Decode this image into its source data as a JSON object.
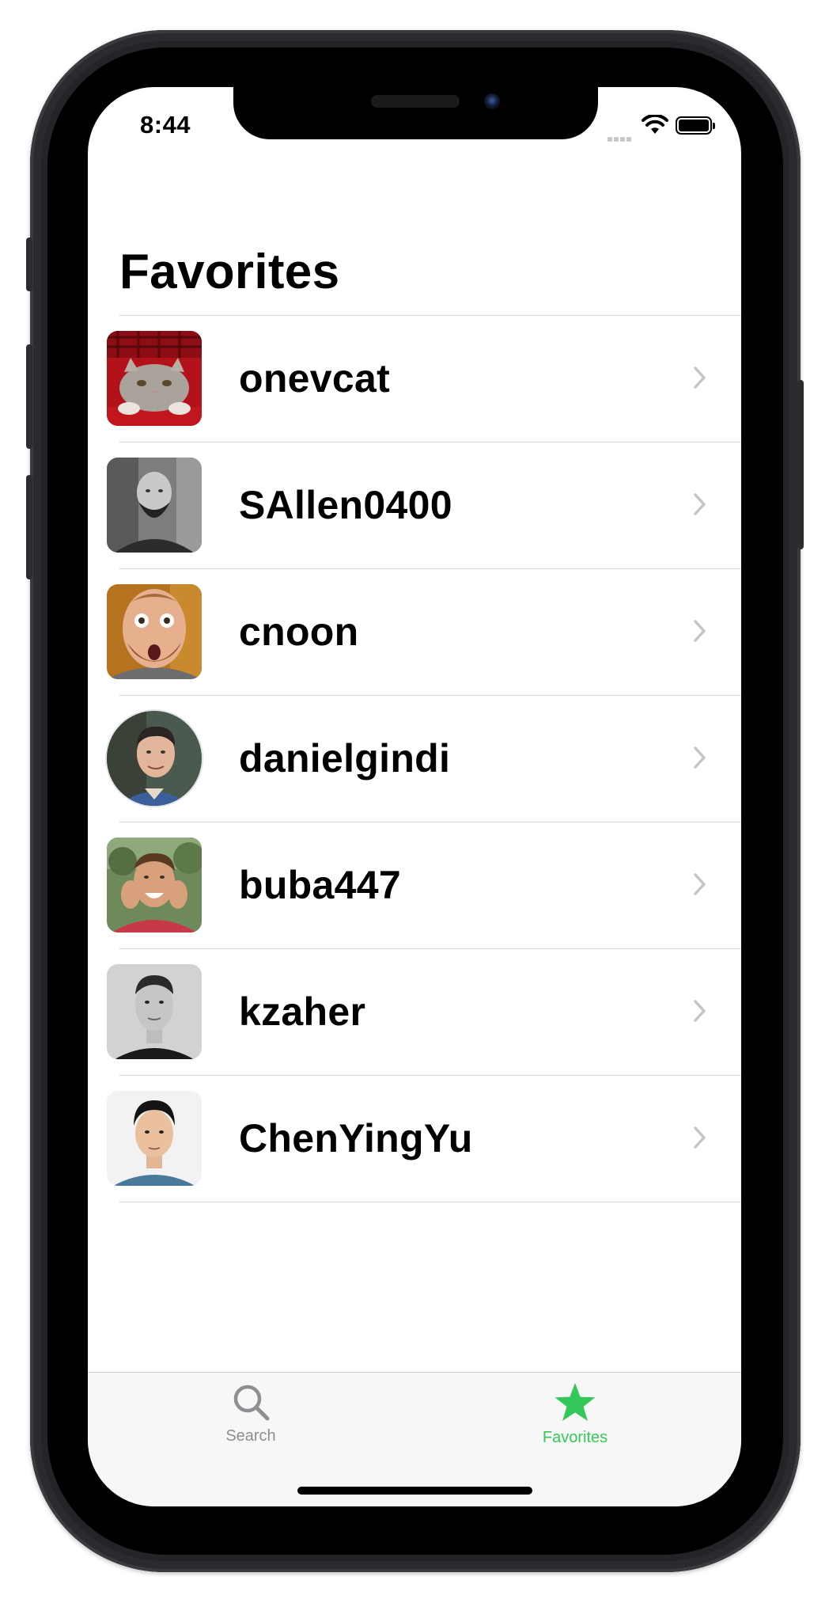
{
  "status_bar": {
    "time": "8:44"
  },
  "header": {
    "title": "Favorites"
  },
  "favorites": [
    {
      "name": "onevcat",
      "avatar": "cat-photo"
    },
    {
      "name": "SAllen0400",
      "avatar": "bearded-man-photo"
    },
    {
      "name": "cnoon",
      "avatar": "surprised-man-photo"
    },
    {
      "name": "danielgindi",
      "avatar": "smiling-man-photo"
    },
    {
      "name": "buba447",
      "avatar": "excited-man-photo"
    },
    {
      "name": "kzaher",
      "avatar": "man-bw-photo"
    },
    {
      "name": "ChenYingYu",
      "avatar": "man-portrait-photo"
    }
  ],
  "tabbar": {
    "search_label": "Search",
    "favorites_label": "Favorites",
    "selected": "Favorites",
    "accent_color": "#34c759",
    "inactive_color": "#8e8e93"
  }
}
